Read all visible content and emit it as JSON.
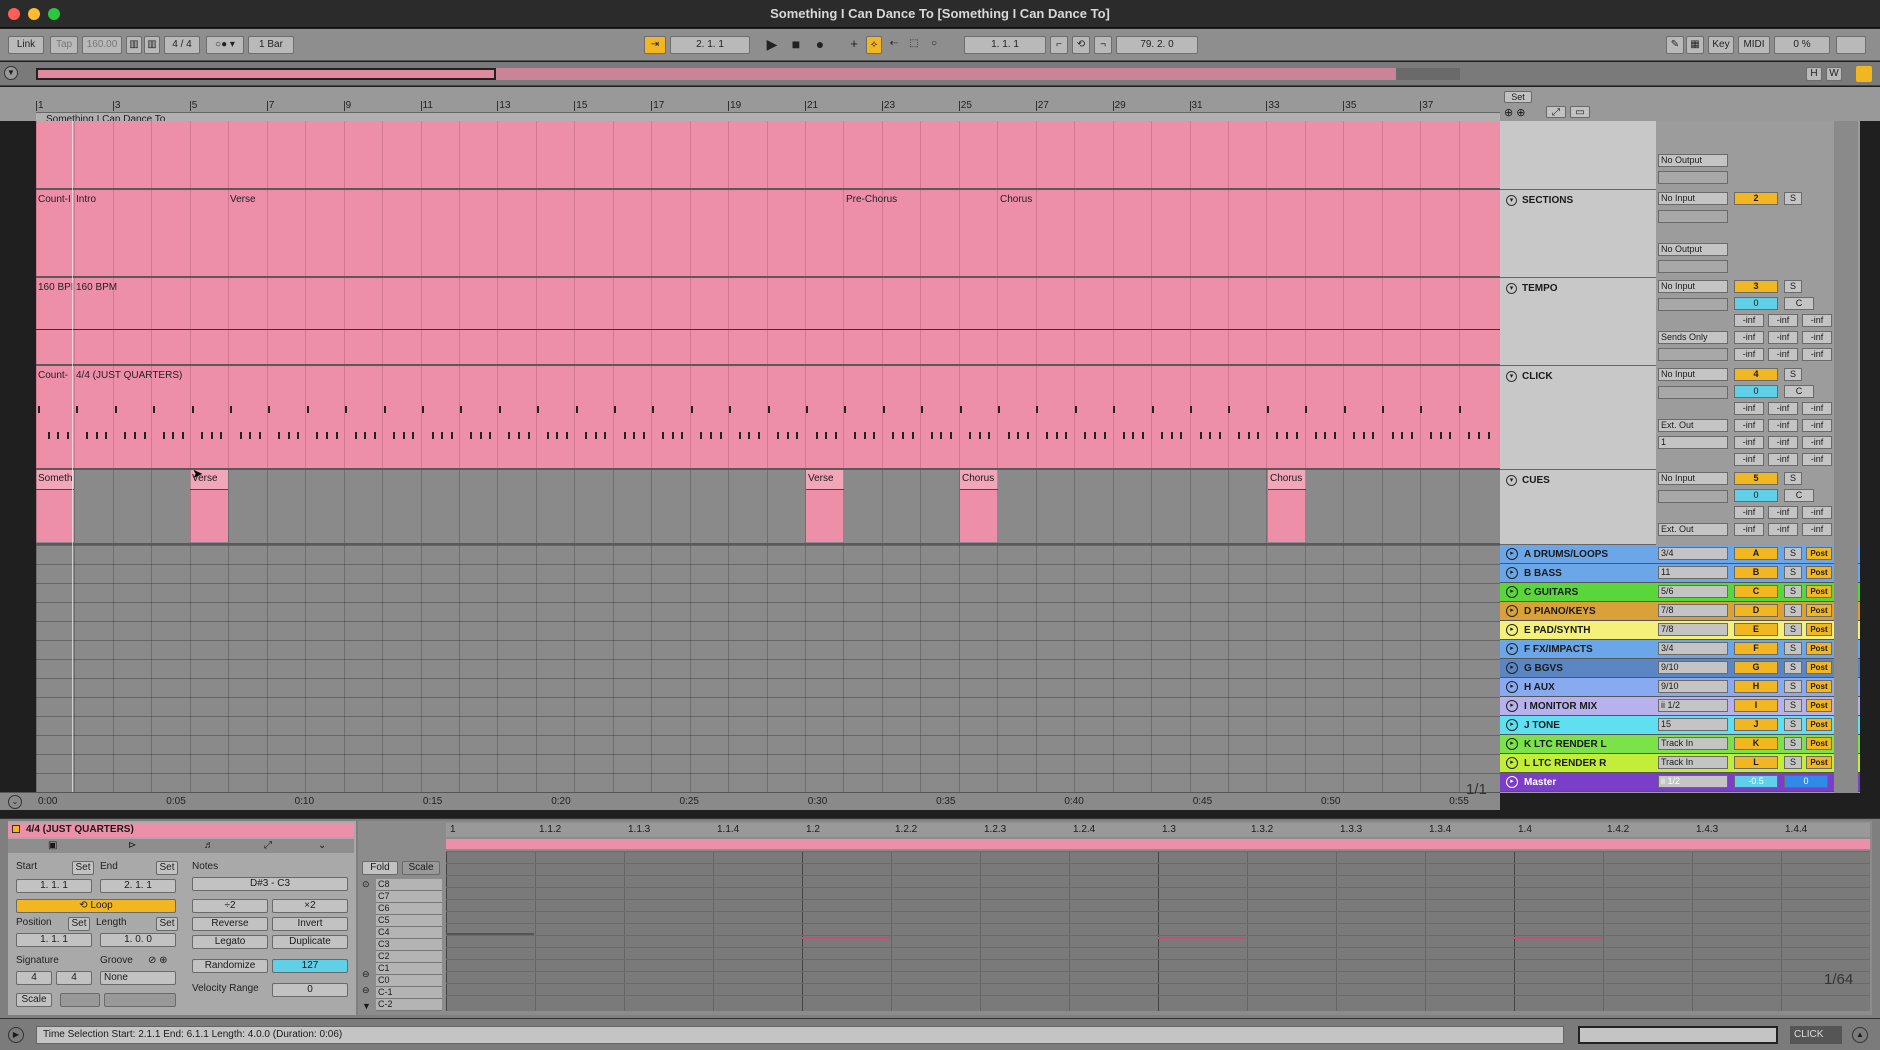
{
  "window": {
    "title": "Something I Can Dance To  [Something I Can Dance To]"
  },
  "control_bar": {
    "link": "Link",
    "tap": "Tap",
    "tempo": "160.00",
    "signature": "4 / 4",
    "quantize": "1 Bar",
    "arrangement_position": "2.   1.   1",
    "loop_start": "1.   1.   1",
    "loop_length": "79.   2.   0",
    "key": "Key",
    "midi": "MIDI",
    "cpu": "0 %"
  },
  "ruler": {
    "bars": [
      "1",
      "3",
      "5",
      "7",
      "9",
      "11",
      "13",
      "15",
      "17",
      "19",
      "21",
      "23",
      "25",
      "27",
      "29",
      "31",
      "33",
      "35",
      "37"
    ],
    "song_title": "Something I Can Dance To",
    "set": "Set",
    "h": "H",
    "w": "W"
  },
  "lanes": {
    "sections": {
      "labels": [
        "Count-I",
        "Intro",
        "Verse",
        "Pre-Chorus",
        "Chorus"
      ]
    },
    "tempo": {
      "labels": [
        "160 BPI",
        "160 BPM"
      ]
    },
    "click": {
      "labels": [
        "Count-",
        "4/4 (JUST QUARTERS)"
      ]
    },
    "cues": {
      "clips": [
        "Someth",
        "Verse",
        "Verse",
        "Chorus",
        "Chorus"
      ]
    }
  },
  "tracks": {
    "top_output": "No Output",
    "sections": {
      "name": "SECTIONS",
      "input": "No Input",
      "output": "No Output",
      "number": "2",
      "solo": "S"
    },
    "tempo": {
      "name": "TEMPO",
      "input": "No Input",
      "sends": "Sends Only",
      "number": "3",
      "solo": "S",
      "vol": "0",
      "pan": "C",
      "inf": "-inf"
    },
    "click": {
      "name": "CLICK",
      "input": "No Input",
      "out": "Ext. Out",
      "ch": "1",
      "number": "4",
      "solo": "S",
      "vol": "0",
      "pan": "C",
      "inf": "-inf",
      "zero": "0"
    },
    "cues": {
      "name": "CUES",
      "input": "No Input",
      "out": "Ext. Out",
      "number": "5",
      "solo": "S",
      "vol": "0",
      "pan": "C",
      "inf": "-inf"
    },
    "groups": [
      {
        "name": "A DRUMS/LOOPS",
        "route": "3/4",
        "letter": "A",
        "color": "#6aa6e8"
      },
      {
        "name": "B BASS",
        "route": "11",
        "letter": "B",
        "color": "#6aa6e8"
      },
      {
        "name": "C GUITARS",
        "route": "5/6",
        "letter": "C",
        "color": "#58d63a"
      },
      {
        "name": "D PIANO/KEYS",
        "route": "7/8",
        "letter": "D",
        "color": "#d9a13a"
      },
      {
        "name": "E PAD/SYNTH",
        "route": "7/8",
        "letter": "E",
        "color": "#f4f07a"
      },
      {
        "name": "F FX/IMPACTS",
        "route": "3/4",
        "letter": "F",
        "color": "#6aa6e8"
      },
      {
        "name": "G BGVS",
        "route": "9/10",
        "letter": "G",
        "color": "#5b86c4"
      },
      {
        "name": "H AUX",
        "route": "9/10",
        "letter": "H",
        "color": "#88aaf0"
      },
      {
        "name": "I MONITOR MIX",
        "route": "ii 1/2",
        "letter": "I",
        "color": "#b7b2ee"
      },
      {
        "name": "J TONE",
        "route": "15",
        "letter": "J",
        "color": "#5fe0f0"
      },
      {
        "name": "K LTC RENDER L",
        "route": "Track In",
        "letter": "K",
        "color": "#7ce24a"
      },
      {
        "name": "L LTC RENDER R",
        "route": "Track In",
        "letter": "L",
        "color": "#c2ee3a"
      }
    ],
    "master": {
      "name": "Master",
      "route": "ii 1/2",
      "vol": "-0.5",
      "pan": "0"
    },
    "solo_label": "S",
    "post_label": "Post"
  },
  "timebar": {
    "marks": [
      "0:00",
      "0:05",
      "0:10",
      "0:15",
      "0:20",
      "0:25",
      "0:30",
      "0:35",
      "0:40",
      "0:45",
      "0:50",
      "0:55"
    ],
    "zoom": "1/1"
  },
  "clip": {
    "name": "4/4 (JUST QUARTERS)",
    "start_label": "Start",
    "end_label": "End",
    "set": "Set",
    "start": "1.   1.   1",
    "end": "2.   1.   1",
    "loop": "Loop",
    "position_label": "Position",
    "length_label": "Length",
    "position": "1.   1.   1",
    "length": "1.   0.   0",
    "signature_label": "Signature",
    "groove_label": "Groove",
    "sig_num": "4",
    "sig_den": "4",
    "groove": "None",
    "scale": "Scale",
    "notes_label": "Notes",
    "note_range": "D#3 - C3",
    "div2": "÷2",
    "mul2": "×2",
    "reverse": "Reverse",
    "invert": "Invert",
    "legato": "Legato",
    "duplicate": "Duplicate",
    "randomize": "Randomize",
    "random_val": "127",
    "vel_range_label": "Velocity Range",
    "vel_range": "0"
  },
  "piano_roll": {
    "fold": "Fold",
    "scale": "Scale",
    "notes": [
      "C8",
      "C7",
      "C6",
      "C5",
      "C4",
      "C3",
      "C2",
      "C1",
      "C0",
      "C-1",
      "C-2"
    ],
    "beats": [
      "1",
      "1.1.2",
      "1.1.3",
      "1.1.4",
      "1.2",
      "1.2.2",
      "1.2.3",
      "1.2.4",
      "1.3",
      "1.3.2",
      "1.3.3",
      "1.3.4",
      "1.4",
      "1.4.2",
      "1.4.3",
      "1.4.4"
    ],
    "zoom": "1/64"
  },
  "status": {
    "text": "Time Selection   Start: 2.1.1   End: 6.1.1   Length: 4.0.0   (Duration: 0:06)",
    "click_label": "CLICK"
  }
}
